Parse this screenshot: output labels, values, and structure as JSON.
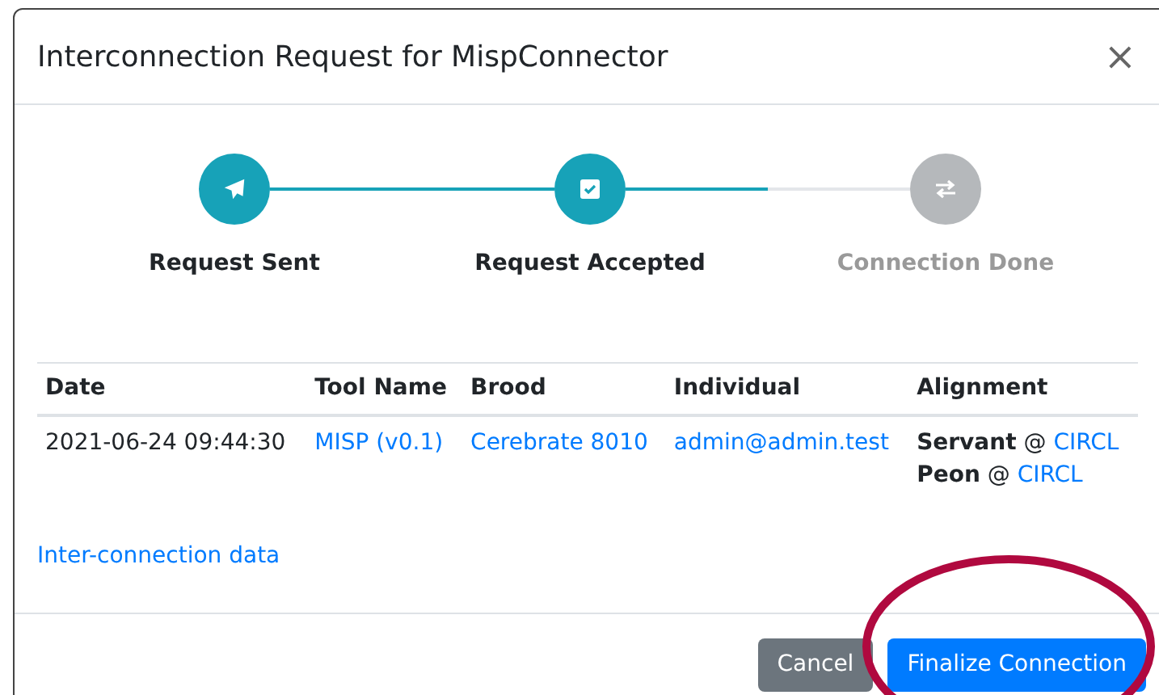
{
  "dialog": {
    "title": "Interconnection Request for MispConnector",
    "close": "×"
  },
  "steps": [
    {
      "label": "Request Sent",
      "done": true
    },
    {
      "label": "Request Accepted",
      "done": true
    },
    {
      "label": "Connection Done",
      "done": false
    }
  ],
  "connectors": [
    {
      "level": 1
    },
    {
      "level": 0.5
    }
  ],
  "table": {
    "columns": [
      "Date",
      "Tool Name",
      "Brood",
      "Individual",
      "Alignment"
    ],
    "rows": [
      {
        "date": "2021-06-24 09:44:30",
        "tool": "MISP (v0.1)",
        "brood": "Cerebrate 8010",
        "individual": "admin@admin.test",
        "alignment": [
          {
            "role": "Servant",
            "at": "@",
            "org": "CIRCL"
          },
          {
            "role": "Peon",
            "at": "@",
            "org": "CIRCL"
          }
        ]
      }
    ]
  },
  "data_link": "Inter-connection data",
  "buttons": [
    {
      "label": "Cancel",
      "kind": "secondary"
    },
    {
      "label": "Finalize Connection",
      "kind": "primary"
    }
  ]
}
